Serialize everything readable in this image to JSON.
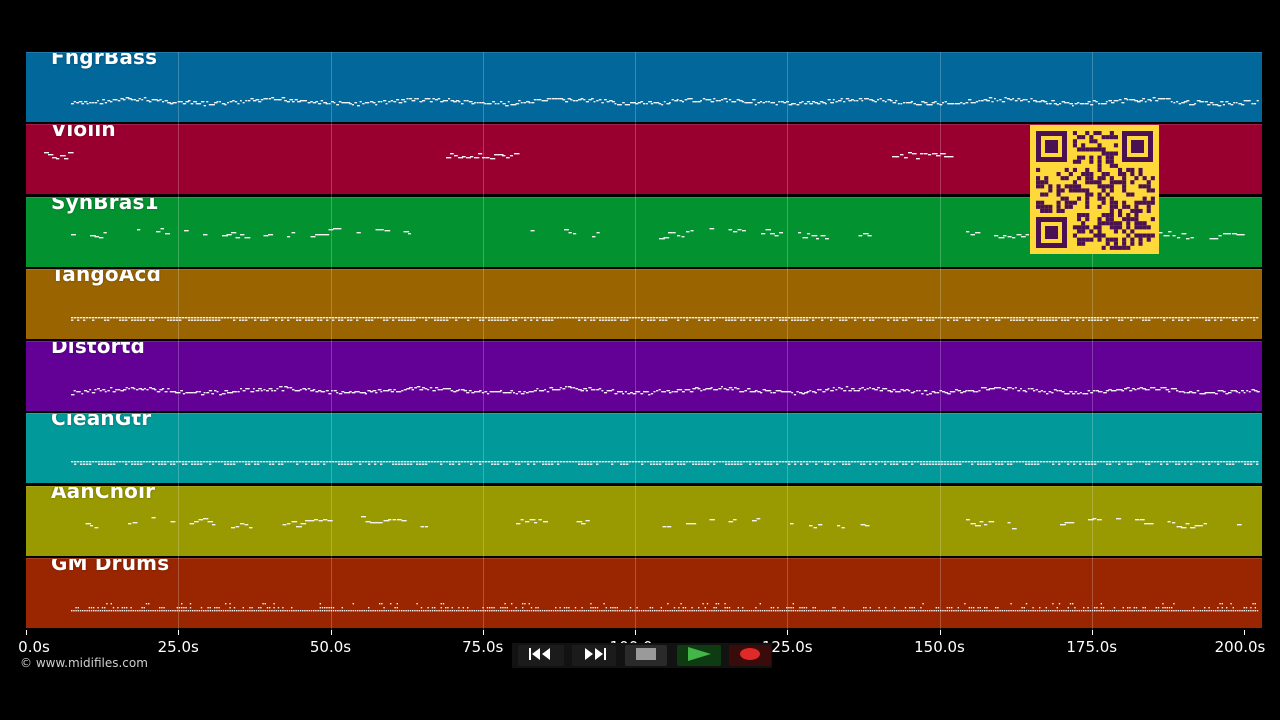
{
  "credit": "© www.midifiles.com",
  "timeline": {
    "ticks": [
      "0.0s",
      "25.0s",
      "50.0s",
      "75.0s",
      "100.0s",
      "125.0s",
      "150.0s",
      "175.0s",
      "200.0s"
    ],
    "duration_s": 200
  },
  "tracks": [
    {
      "name": "FngrBass",
      "color": "#02679a",
      "style": "dense"
    },
    {
      "name": "Violin",
      "color": "#990030",
      "style": "sparse"
    },
    {
      "name": "SynBras1",
      "color": "#039230",
      "style": "phrases"
    },
    {
      "name": "TangoAcd",
      "color": "#9a6500",
      "style": "bars"
    },
    {
      "name": "Distortd",
      "color": "#630096",
      "style": "dense"
    },
    {
      "name": "CleanGtr",
      "color": "#02999a",
      "style": "bars"
    },
    {
      "name": "AahChoir",
      "color": "#999901",
      "style": "phrases"
    },
    {
      "name": "GM Drums",
      "color": "#992600",
      "style": "drums"
    }
  ],
  "transport": {
    "buttons": [
      {
        "name": "rewind-button",
        "icon": "rewind-icon"
      },
      {
        "name": "fast-forward-button",
        "icon": "fast-forward-icon"
      },
      {
        "name": "stop-button",
        "icon": "stop-icon"
      },
      {
        "name": "play-button",
        "icon": "play-icon"
      },
      {
        "name": "record-button",
        "icon": "record-icon"
      }
    ]
  },
  "qr_code": {
    "icon": "qr-code-icon",
    "color": "#ffd83a"
  }
}
